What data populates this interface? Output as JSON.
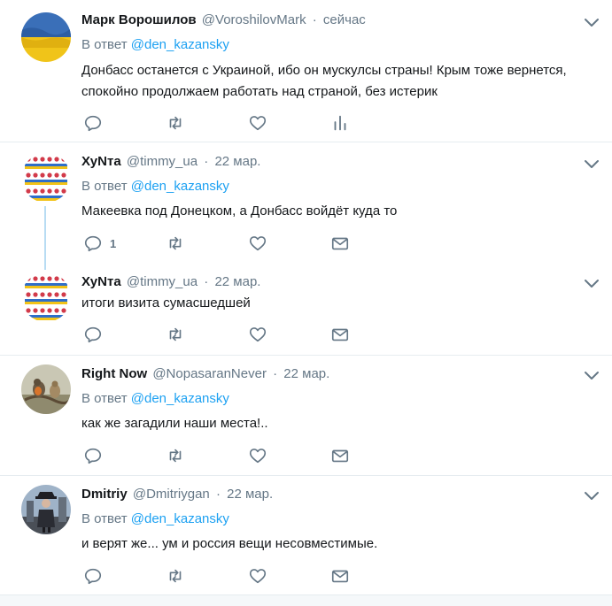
{
  "reply_prefix": "В ответ",
  "tweets": [
    {
      "name": "Марк Ворошилов",
      "handle": "@VoroshilovMark",
      "time": "сейчас",
      "reply_to": "@den_kazansky",
      "text": "Донбасс останется с Украиной, ибо он мускулсы страны! Крым тоже вернется, спокойно продолжаем работать над страной, без истерик",
      "reply_count": "",
      "avatar_icon": "ukraine-flag-avatar"
    },
    {
      "name": "ХуNта",
      "handle": "@timmy_ua",
      "time": "22 мар.",
      "reply_to": "@den_kazansky",
      "text": "Макеевка под Донецком, а Донбасс войдёт куда то",
      "reply_count": "1",
      "avatar_icon": "hearts-pattern-avatar"
    },
    {
      "name": "ХуNта",
      "handle": "@timmy_ua",
      "time": "22 мар.",
      "reply_to": "",
      "text": "итоги визита сумасшедшей",
      "reply_count": "",
      "avatar_icon": "hearts-pattern-avatar"
    },
    {
      "name": "Right Now",
      "handle": "@NopasaranNever",
      "time": "22 мар.",
      "reply_to": "@den_kazansky",
      "text": "как же загадили наши места!..",
      "reply_count": "",
      "avatar_icon": "birds-avatar"
    },
    {
      "name": "Dmitriy",
      "handle": "@Dmitriygan",
      "time": "22 мар.",
      "reply_to": "@den_kazansky",
      "text": "и верят же... ум и россия вещи несовместимые.",
      "reply_count": "",
      "avatar_icon": "character-avatar"
    }
  ],
  "icons": {
    "reply": "reply-icon",
    "retweet": "retweet-icon",
    "like": "like-icon",
    "analytics": "analytics-icon",
    "dm": "direct-message-icon",
    "more": "chevron-down-icon"
  },
  "colors": {
    "accent": "#1da1f2",
    "secondary_text": "#657786",
    "border": "#e6ecf0",
    "thread_line": "#b8dcf3"
  }
}
